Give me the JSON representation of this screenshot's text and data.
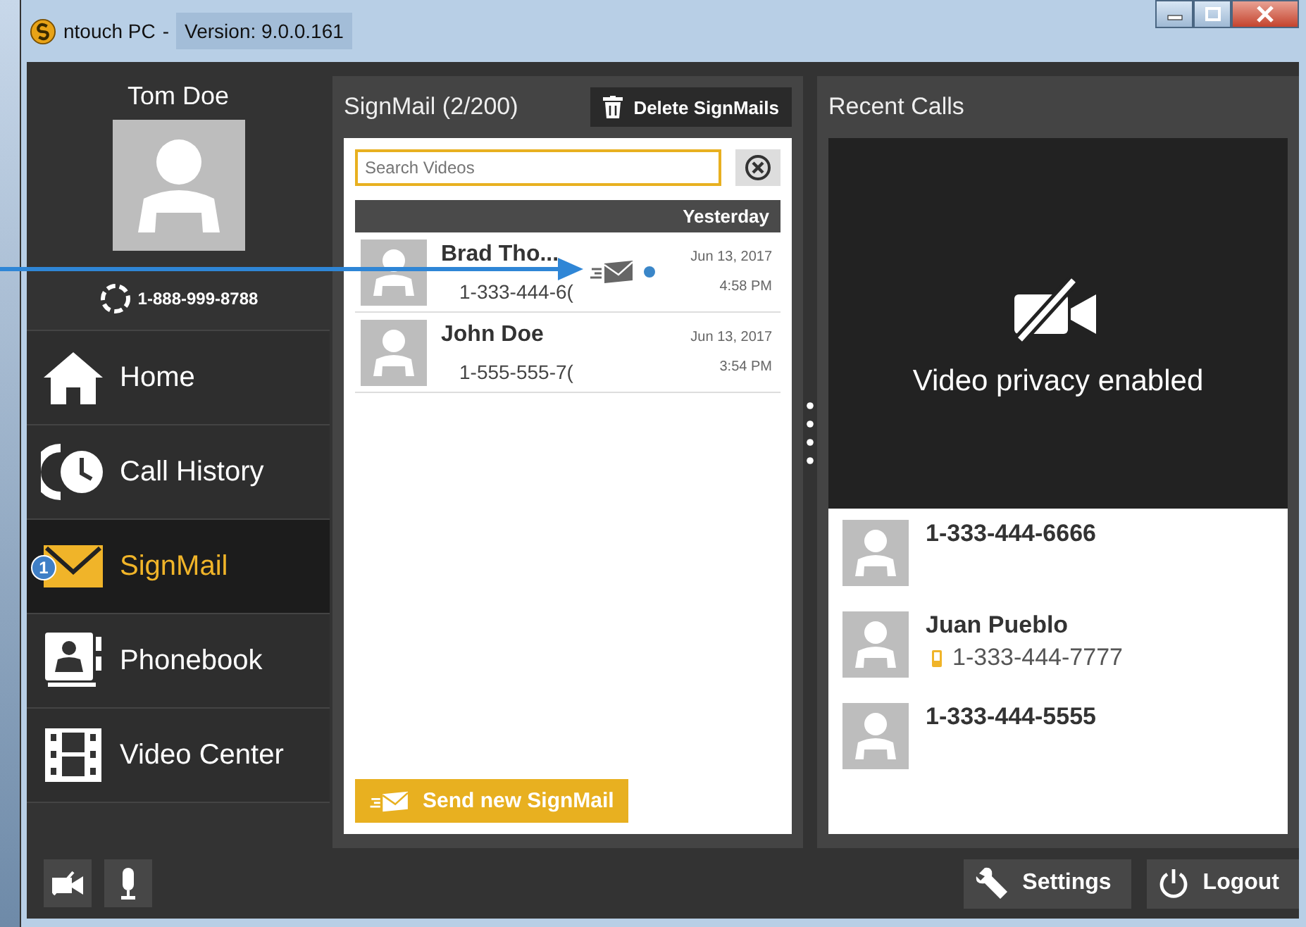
{
  "window": {
    "app_name": "ntouch PC",
    "separator": "-",
    "version": "Version:  9.0.0.161"
  },
  "sidebar": {
    "user_name": "Tom Doe",
    "phone": "1-888-999-8788",
    "items": [
      {
        "kind": "home",
        "label": "Home",
        "selected": false
      },
      {
        "kind": "history",
        "label": "Call History",
        "selected": false
      },
      {
        "kind": "signmail",
        "label": "SignMail",
        "selected": true,
        "badge": "1"
      },
      {
        "kind": "phonebook",
        "label": "Phonebook",
        "selected": false
      },
      {
        "kind": "video",
        "label": "Video Center",
        "selected": false
      }
    ]
  },
  "signmail": {
    "title": "SignMail (2/200)",
    "delete_button": "Delete SignMails",
    "search": {
      "placeholder": "Search Videos"
    },
    "group": "Yesterday",
    "rows": [
      {
        "name": "Brad Tho...",
        "number": "1-333-444-6(",
        "date": "Jun 13, 2017",
        "time": "4:58 PM",
        "unread": true
      },
      {
        "name": "John Doe",
        "number": "1-555-555-7(",
        "date": "Jun 13, 2017",
        "time": "3:54 PM",
        "unread": false
      }
    ],
    "send_button": "Send new SignMail"
  },
  "recent_calls": {
    "title": "Recent Calls",
    "video_status": "Video privacy enabled",
    "calls": [
      {
        "name": "1-333-444-6666"
      },
      {
        "name": "Juan Pueblo",
        "number": "1-333-444-7777",
        "mobile": true
      },
      {
        "name": "1-333-444-5555"
      }
    ]
  },
  "bottom_bar": {
    "settings": "Settings",
    "logout": "Logout"
  }
}
